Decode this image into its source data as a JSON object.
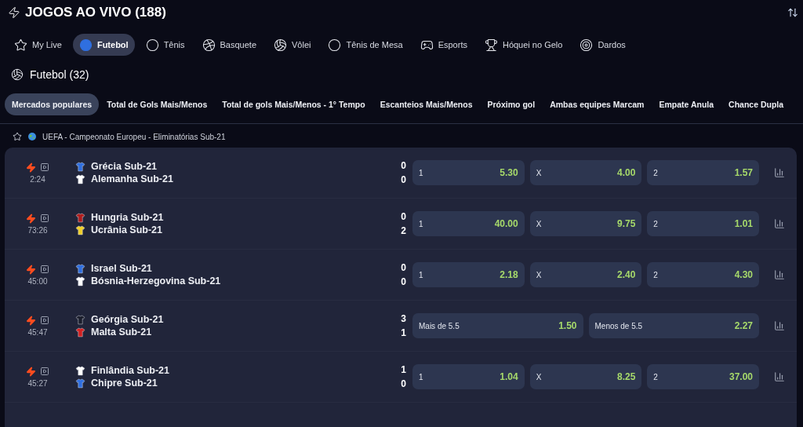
{
  "header": {
    "title": "JOGOS AO VIVO (188)"
  },
  "sports": [
    {
      "label": "My Live",
      "selected": false
    },
    {
      "label": "Futebol",
      "selected": true
    },
    {
      "label": "Tênis",
      "selected": false
    },
    {
      "label": "Basquete",
      "selected": false
    },
    {
      "label": "Vôlei",
      "selected": false
    },
    {
      "label": "Tênis de Mesa",
      "selected": false
    },
    {
      "label": "Esports",
      "selected": false
    },
    {
      "label": "Hóquei no Gelo",
      "selected": false
    },
    {
      "label": "Dardos",
      "selected": false
    }
  ],
  "section_title": "Futebol (32)",
  "markets": [
    {
      "label": "Mercados populares",
      "selected": true
    },
    {
      "label": "Total de Gols Mais/Menos",
      "selected": false
    },
    {
      "label": "Total de gols Mais/Menos - 1° Tempo",
      "selected": false
    },
    {
      "label": "Escanteios Mais/Menos",
      "selected": false
    },
    {
      "label": "Próximo gol",
      "selected": false
    },
    {
      "label": "Ambas equipes Marcam",
      "selected": false
    },
    {
      "label": "Empate Anula",
      "selected": false
    },
    {
      "label": "Chance Dupla",
      "selected": false
    }
  ],
  "league": {
    "name": "UEFA - Campeonato Europeu - Eliminatórias Sub-21",
    "favorite": false
  },
  "matches": [
    {
      "time": "2:24",
      "teams": [
        {
          "name": "Grécia Sub-21",
          "score": "0",
          "color": "#2f6fe0"
        },
        {
          "name": "Alemanha Sub-21",
          "score": "0",
          "color": "#ffffff"
        }
      ],
      "odds": [
        {
          "label": "1",
          "value": "5.30"
        },
        {
          "label": "X",
          "value": "4.00"
        },
        {
          "label": "2",
          "value": "1.57"
        }
      ]
    },
    {
      "time": "73:26",
      "teams": [
        {
          "name": "Hungria Sub-21",
          "score": "0",
          "color": "#b01c1c"
        },
        {
          "name": "Ucrânia Sub-21",
          "score": "2",
          "color": "#f2d027"
        }
      ],
      "odds": [
        {
          "label": "1",
          "value": "40.00"
        },
        {
          "label": "X",
          "value": "9.75"
        },
        {
          "label": "2",
          "value": "1.01"
        }
      ]
    },
    {
      "time": "45:00",
      "teams": [
        {
          "name": "Israel Sub-21",
          "score": "0",
          "color": "#2f6fe0"
        },
        {
          "name": "Bósnia-Herzegovina Sub-21",
          "score": "0",
          "color": "#ffffff"
        }
      ],
      "odds": [
        {
          "label": "1",
          "value": "2.18"
        },
        {
          "label": "X",
          "value": "2.40"
        },
        {
          "label": "2",
          "value": "4.30"
        }
      ]
    },
    {
      "time": "45:47",
      "teams": [
        {
          "name": "Geórgia Sub-21",
          "score": "3",
          "color": "#1b1e2c"
        },
        {
          "name": "Malta Sub-21",
          "score": "1",
          "color": "#d42020"
        }
      ],
      "odds": [
        {
          "label": "Mais de 5.5",
          "value": "1.50"
        },
        {
          "label": "Menos de 5.5",
          "value": "2.27"
        }
      ]
    },
    {
      "time": "45:27",
      "teams": [
        {
          "name": "Finlândia Sub-21",
          "score": "1",
          "color": "#ffffff"
        },
        {
          "name": "Chipre Sub-21",
          "score": "0",
          "color": "#2f6fe0"
        }
      ],
      "odds": [
        {
          "label": "1",
          "value": "1.04"
        },
        {
          "label": "X",
          "value": "8.25"
        },
        {
          "label": "2",
          "value": "37.00"
        }
      ]
    }
  ]
}
